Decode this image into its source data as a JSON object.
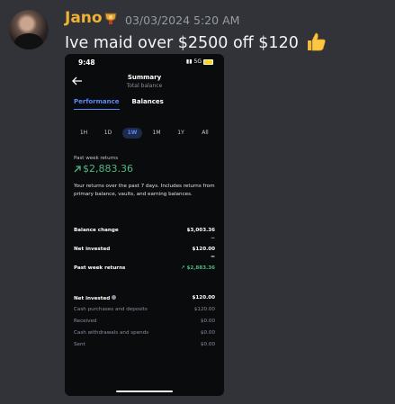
{
  "message": {
    "username": "Jano",
    "timestamp": "03/03/2024 5:20 AM",
    "text": "Ive maid over $2500 off $120",
    "role_badge_icon": "trophy-badge-icon",
    "emoji_icon": "thumbs-up-icon",
    "username_color": "#f0b232"
  },
  "phone": {
    "status_bar": {
      "time": "9:48",
      "network": "5G",
      "battery_level": "14"
    },
    "header": {
      "title": "Summary",
      "subtitle": "Total balance"
    },
    "tabs": [
      {
        "label": "Performance",
        "active": true
      },
      {
        "label": "Balances",
        "active": false
      }
    ],
    "ranges": [
      "1H",
      "1D",
      "1W",
      "1M",
      "1Y",
      "All"
    ],
    "active_range": "1W",
    "returns": {
      "label": "Past week returns",
      "value": "$2,883.36",
      "description": "Your returns over the past 7 days. Includes returns from primary balance, vaults, and earning balances."
    },
    "breakdown": [
      {
        "label": "Balance change",
        "value": "$3,003.36",
        "op": "−"
      },
      {
        "label": "Net invested",
        "value": "$120.00",
        "op": "="
      },
      {
        "label": "Past week returns",
        "value": "$2,883.36"
      }
    ],
    "net_invested": {
      "label": "Net invested",
      "value": "$120.00",
      "items": [
        {
          "label": "Cash purchases and deposits",
          "value": "$120.00"
        },
        {
          "label": "Received",
          "value": "$0.00"
        },
        {
          "label": "Cash withdrawals and spends",
          "value": "$0.00"
        },
        {
          "label": "Sent",
          "value": "$0.00"
        }
      ]
    },
    "accent_color": "#578bfa",
    "positive_color": "#4fb87f"
  }
}
